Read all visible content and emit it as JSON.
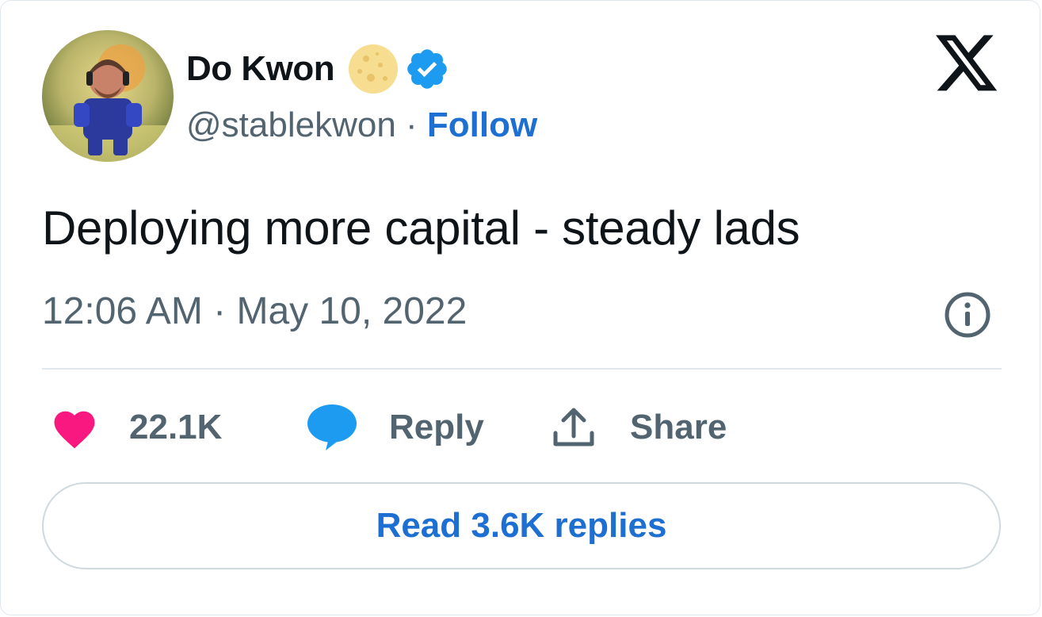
{
  "author": {
    "display_name": "Do Kwon",
    "handle": "@stablekwon",
    "separator": "·",
    "follow_label": "Follow",
    "badges": [
      "moon-icon",
      "verified-icon"
    ]
  },
  "tweet": {
    "text": "Deploying more capital - steady lads",
    "timestamp": "12:06 AM · May 10, 2022"
  },
  "actions": {
    "like_count": "22.1K",
    "reply_label": "Reply",
    "share_label": "Share"
  },
  "read_replies_label": "Read 3.6K replies",
  "colors": {
    "accent": "#1d6fd1",
    "verified": "#1d9bf0",
    "like": "#f91880",
    "secondary_text": "#536471",
    "primary_text": "#0f1419"
  }
}
